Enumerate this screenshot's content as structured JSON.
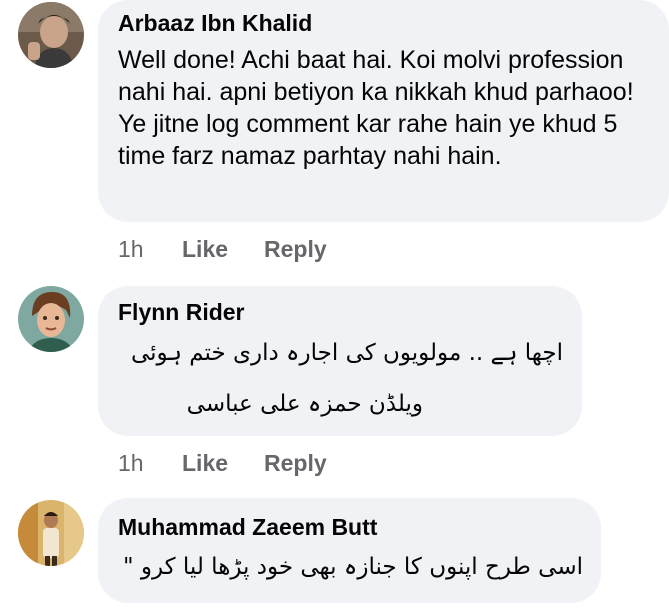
{
  "comments": [
    {
      "author": "Arbaaz Ibn Khalid",
      "body": "Well done! Achi baat hai. Koi molvi profession nahi hai. apni betiyon ka nikkah khud parhaoo! Ye jitne log comment kar rahe hain ye khud 5 time farz namaz parhtay nahi hain.",
      "time": "1h",
      "like": "Like",
      "reply": "Reply",
      "avatar_icon": "profile-photo-man"
    },
    {
      "author": "Flynn Rider",
      "body_lines": [
        "اچھا ہے .. مولویوں کی اجارہ داری ختم ہوئی",
        "ویلڈن حمزہ علی عباسی"
      ],
      "time": "1h",
      "like": "Like",
      "reply": "Reply",
      "avatar_icon": "cartoon-character-avatar"
    },
    {
      "author": "Muhammad Zaeem Butt",
      "body_lines": [
        "اسی طرح اپنوں کا جنازہ بھی خود پڑھا لیا کرو \""
      ],
      "avatar_icon": "profile-photo-man-standing"
    }
  ],
  "colors": {
    "bubble": "#f0f2f5",
    "meta_text": "#65676b",
    "text": "#050505"
  }
}
